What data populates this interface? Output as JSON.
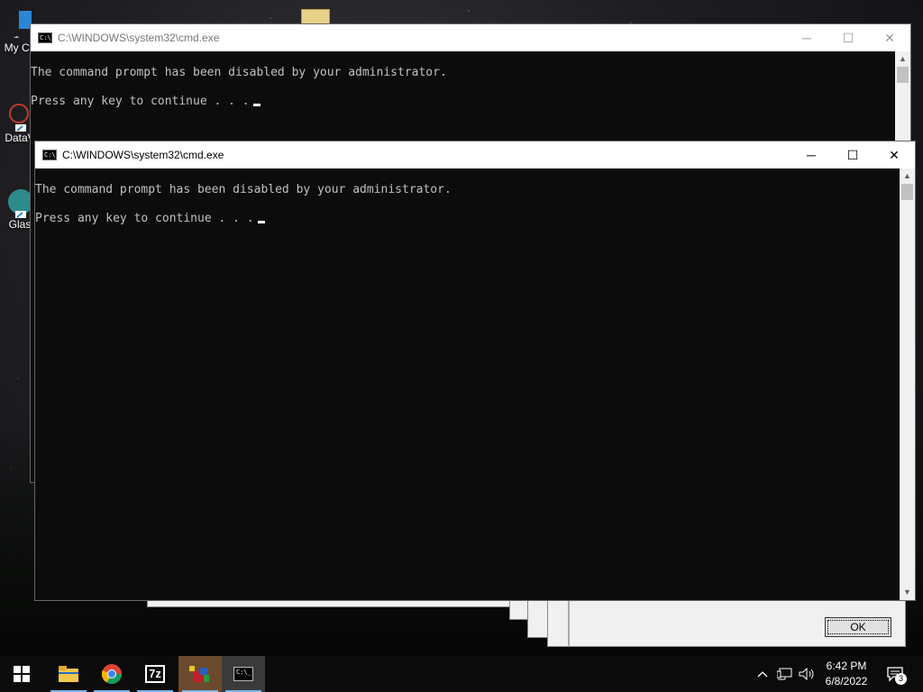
{
  "desktop": {
    "icons": [
      {
        "label": "My Co",
        "icon": "computer-icon"
      },
      {
        "label": "DataV",
        "icon": "app-icon"
      },
      {
        "label": "Glas",
        "icon": "app-icon"
      }
    ]
  },
  "back_dialog": {
    "ok_label": "OK"
  },
  "cmd_back": {
    "title": "C:\\WINDOWS\\system32\\cmd.exe",
    "lines": [
      "The command prompt has been disabled by your administrator.",
      "Press any key to continue . . ."
    ]
  },
  "cmd_front": {
    "title": "C:\\WINDOWS\\system32\\cmd.exe",
    "lines": [
      "The command prompt has been disabled by your administrator.",
      "Press any key to continue . . ."
    ]
  },
  "window_controls": {
    "minimize": "─",
    "maximize": "☐",
    "close": "✕"
  },
  "taskbar": {
    "apps": [
      {
        "name": "start",
        "icon": "windows-logo-icon"
      },
      {
        "name": "file-explorer",
        "icon": "folder-icon"
      },
      {
        "name": "chrome",
        "icon": "chrome-icon"
      },
      {
        "name": "7zip",
        "icon": "7zip-icon",
        "text": "7z"
      },
      {
        "name": "boxes-app",
        "icon": "boxes-icon"
      },
      {
        "name": "cmd",
        "icon": "cmd-icon"
      }
    ],
    "clock_time": "6:42 PM",
    "clock_date": "6/8/2022",
    "notification_count": "3"
  }
}
